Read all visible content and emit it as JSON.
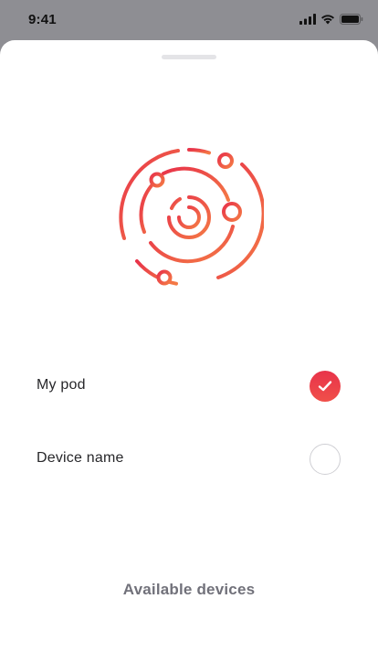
{
  "status_bar": {
    "time": "9:41",
    "icons": [
      "signal-icon",
      "wifi-icon",
      "battery-icon"
    ]
  },
  "sheet": {
    "logo_icon": "orbit-logo-icon",
    "devices": [
      {
        "label": "My pod",
        "selected": true
      },
      {
        "label": "Device name",
        "selected": false
      }
    ],
    "available_title": "Available devices"
  },
  "colors": {
    "accent_start": "#e8334a",
    "accent_end": "#f47a45",
    "backdrop": "#8e8e93",
    "text_primary": "#27272a",
    "text_secondary": "#71717a"
  }
}
